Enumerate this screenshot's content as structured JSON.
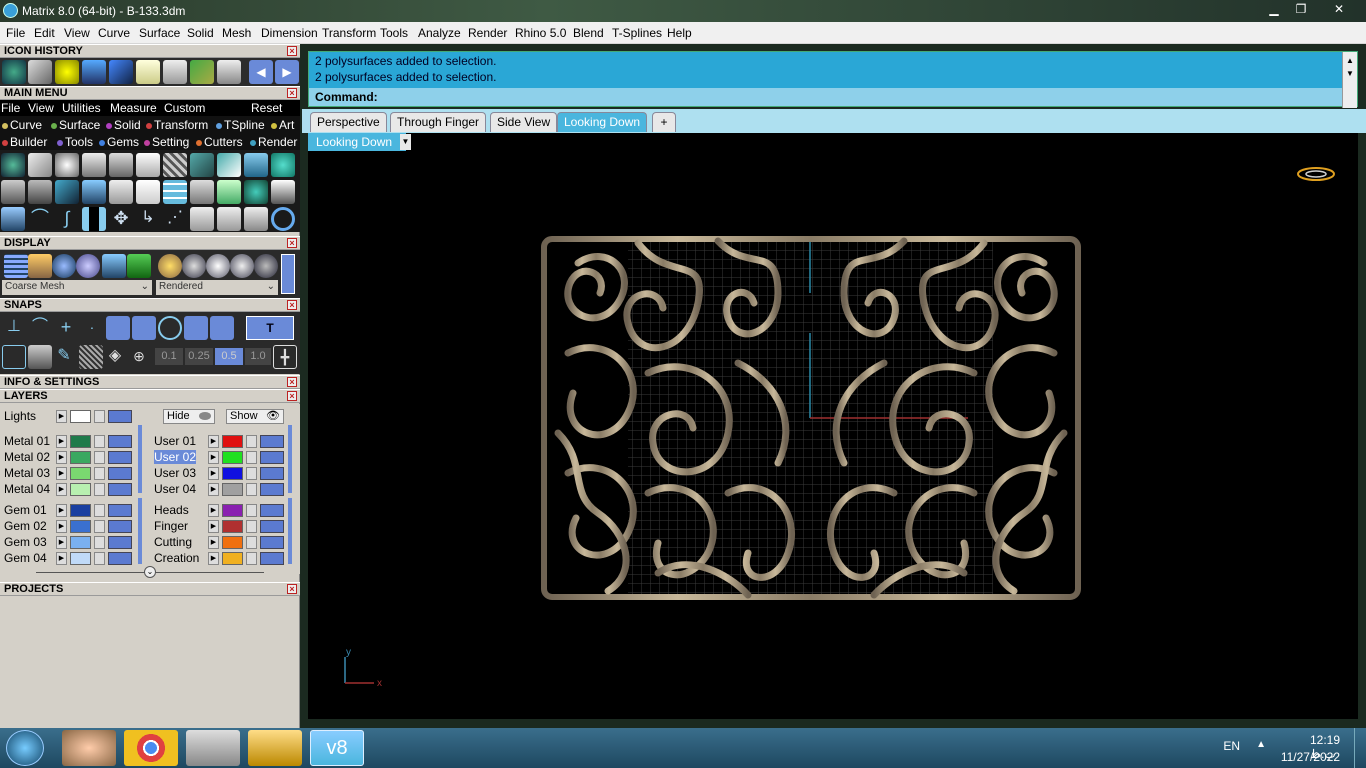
{
  "window": {
    "title": "Matrix 8.0 (64-bit) - B-133.3dm",
    "minimize": "▁",
    "restore": "❐",
    "close": "✕"
  },
  "menu": [
    "File",
    "Edit",
    "View",
    "Curve",
    "Surface",
    "Solid",
    "Mesh",
    "Dimension",
    "Transform",
    "Tools",
    "Analyze",
    "Render",
    "Rhino 5.0",
    "Blend",
    "T-Splines",
    "Help"
  ],
  "sections": {
    "icon_history": "ICON HISTORY",
    "main_menu": "MAIN MENU",
    "display": "DISPLAY",
    "snaps": "SNAPS",
    "info": "INFO & SETTINGS",
    "layers": "LAYERS",
    "projects": "PROJECTS"
  },
  "main_menu": {
    "items": [
      "File",
      "View",
      "Utilities",
      "Measure",
      "Custom"
    ],
    "reset": "Reset",
    "row1": [
      {
        "label": "Curve",
        "color": "#d4c060"
      },
      {
        "label": "Surface",
        "color": "#6ab04c"
      },
      {
        "label": "Solid",
        "color": "#b040c0"
      },
      {
        "label": "Transform",
        "color": "#d04040"
      },
      {
        "label": "TSpline",
        "color": "#60a0e0"
      },
      {
        "label": "Art",
        "color": "#d0c040"
      }
    ],
    "row2": [
      {
        "label": "Builder",
        "color": "#d04040"
      },
      {
        "label": "Tools",
        "color": "#8060d0"
      },
      {
        "label": "Gems",
        "color": "#4080e0"
      },
      {
        "label": "Setting",
        "color": "#c040a0"
      },
      {
        "label": "Cutters",
        "color": "#e07030"
      },
      {
        "label": "Render",
        "color": "#40a0c0"
      }
    ]
  },
  "display": {
    "mesh": "Coarse Mesh",
    "mode": "Rendered"
  },
  "snaps": {
    "values": [
      "0.1",
      "0.25",
      "0.5",
      "1.0"
    ]
  },
  "layers": {
    "lights": "Lights",
    "hide": "Hide",
    "show": "Show",
    "left": [
      {
        "name": "Metal 01",
        "color": "#1f7a4a"
      },
      {
        "name": "Metal 02",
        "color": "#3aa860"
      },
      {
        "name": "Metal 03",
        "color": "#7ad870"
      },
      {
        "name": "Metal 04",
        "color": "#b8f0b0"
      },
      {
        "name": "Gem 01",
        "color": "#1a3fa0"
      },
      {
        "name": "Gem 02",
        "color": "#3a70d0"
      },
      {
        "name": "Gem 03",
        "color": "#7ab0f0"
      },
      {
        "name": "Gem 04",
        "color": "#c0daf8"
      }
    ],
    "right": [
      {
        "name": "User 01",
        "color": "#e01010"
      },
      {
        "name": "User 02",
        "color": "#20e020"
      },
      {
        "name": "User 03",
        "color": "#1010e0"
      },
      {
        "name": "User 04",
        "color": "#a0a0a0"
      },
      {
        "name": "Heads",
        "color": "#8a20b0"
      },
      {
        "name": "Finger",
        "color": "#b03030"
      },
      {
        "name": "Cutting",
        "color": "#f07010"
      },
      {
        "name": "Creation",
        "color": "#f0b020"
      }
    ]
  },
  "command": {
    "lines": [
      "2 polysurfaces added to selection.",
      "2 polysurfaces added to selection."
    ],
    "prompt": "Command:"
  },
  "tabs": [
    "Perspective",
    "Through Finger",
    "Side View",
    "Looking Down"
  ],
  "active_tab": "Looking Down",
  "tab_add": "+",
  "viewport": {
    "name": "Looking Down",
    "axis_x": "x",
    "axis_y": "y"
  },
  "taskbar": {
    "language": "EN",
    "time": "12:19 ب.ظ",
    "date": "11/27/2022",
    "matrix_label": "v8"
  }
}
